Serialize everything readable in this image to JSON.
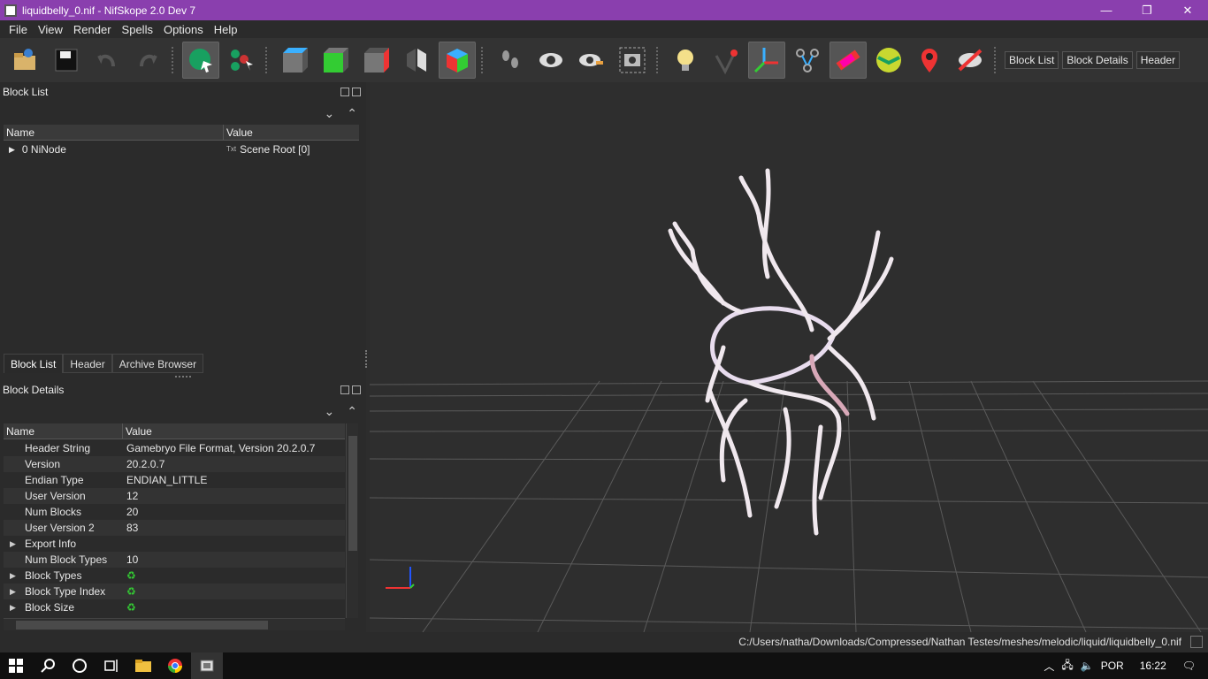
{
  "window": {
    "title": "liquidbelly_0.nif - NifSkope 2.0 Dev 7",
    "minimize": "—",
    "maximize": "❐",
    "close": "✕"
  },
  "menu": [
    "File",
    "View",
    "Render",
    "Spells",
    "Options",
    "Help"
  ],
  "toolbar": {
    "block_list": "Block List",
    "block_details": "Block Details",
    "header": "Header"
  },
  "block_list": {
    "title": "Block List",
    "columns": [
      "Name",
      "Value"
    ],
    "rows": [
      {
        "name": "0 NiNode",
        "value": "Scene Root [0]"
      }
    ]
  },
  "tabs": [
    "Block List",
    "Header",
    "Archive Browser"
  ],
  "block_details": {
    "title": "Block Details",
    "columns": [
      "Name",
      "Value"
    ],
    "rows": [
      {
        "name": "Header String",
        "value": "Gamebryo File Format, Version 20.2.0.7",
        "expandable": false
      },
      {
        "name": "Version",
        "value": "20.2.0.7",
        "expandable": false
      },
      {
        "name": "Endian Type",
        "value": "ENDIAN_LITTLE",
        "expandable": false
      },
      {
        "name": "User Version",
        "value": "12",
        "expandable": false
      },
      {
        "name": "Num Blocks",
        "value": "20",
        "expandable": false
      },
      {
        "name": "User Version 2",
        "value": "83",
        "expandable": false
      },
      {
        "name": "Export Info",
        "value": "",
        "expandable": true
      },
      {
        "name": "Num Block Types",
        "value": "10",
        "expandable": false
      },
      {
        "name": "Block Types",
        "value": "",
        "expandable": true,
        "icon": "refresh-icon"
      },
      {
        "name": "Block Type Index",
        "value": "",
        "expandable": true,
        "icon": "refresh-icon"
      },
      {
        "name": "Block Size",
        "value": "",
        "expandable": true,
        "icon": "refresh-icon"
      }
    ]
  },
  "status": {
    "path": "C:/Users/natha/Downloads/Compressed/Nathan Testes/meshes/melodic/liquid/liquidbelly_0.nif"
  },
  "taskbar": {
    "language": "POR",
    "time": "16:22"
  },
  "colors": {
    "titlebar": "#8a3fae",
    "background": "#2d2d2d",
    "accent_green": "#18a060"
  }
}
